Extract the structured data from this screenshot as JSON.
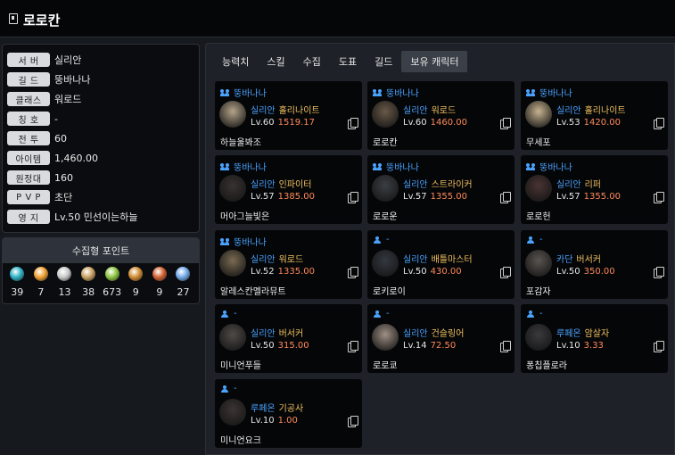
{
  "header": {
    "title": "로로칸"
  },
  "info": [
    {
      "label": "서   버",
      "value": "실리안"
    },
    {
      "label": "길   드",
      "value": "뚱바나나"
    },
    {
      "label": "클래스",
      "value": "워로드"
    },
    {
      "label": "칭   호",
      "value": "-"
    },
    {
      "label": "전   투",
      "value": "60"
    },
    {
      "label": "아이템",
      "value": "1,460.00"
    },
    {
      "label": "원정대",
      "value": "160"
    },
    {
      "label": "P V P",
      "value": "초단"
    },
    {
      "label": "영   지",
      "value": "Lv.50 민선이는하늘"
    }
  ],
  "collection": {
    "title": "수집형 포인트",
    "items": [
      {
        "icon": "island-heart-icon",
        "color": "#2bb0c4",
        "count": "39"
      },
      {
        "icon": "orpheus-star-icon",
        "color": "#f0a030",
        "count": "7"
      },
      {
        "icon": "giant-heart-icon",
        "color": "#c9c9c9",
        "count": "13"
      },
      {
        "icon": "art-piece-icon",
        "color": "#c8a060",
        "count": "38"
      },
      {
        "icon": "mokoko-seed-icon",
        "color": "#8cc63f",
        "count": "673"
      },
      {
        "icon": "voyage-icon",
        "color": "#d08a30",
        "count": "9"
      },
      {
        "icon": "world-tree-leaf-icon",
        "color": "#d06030",
        "count": "9"
      },
      {
        "icon": "ignea-token-icon",
        "color": "#6fa8e8",
        "count": "27"
      }
    ]
  },
  "tabs": [
    {
      "label": "능력치",
      "active": false
    },
    {
      "label": "스킬",
      "active": false
    },
    {
      "label": "수집",
      "active": false
    },
    {
      "label": "도표",
      "active": false
    },
    {
      "label": "길드",
      "active": false
    },
    {
      "label": "보유 캐릭터",
      "active": true
    }
  ],
  "characters": [
    {
      "guild": "뚱바나나",
      "server": "실리안",
      "job": "홀리나이트",
      "level": "Lv.60",
      "ilvl": "1519.17",
      "name": "하늘울봐조",
      "avatar": "#b5a48a"
    },
    {
      "guild": "뚱바나나",
      "server": "실리안",
      "job": "워로드",
      "level": "Lv.60",
      "ilvl": "1460.00",
      "name": "로로칸",
      "avatar": "#6a5a48"
    },
    {
      "guild": "뚱바나나",
      "server": "실리안",
      "job": "홀리나이트",
      "level": "Lv.53",
      "ilvl": "1420.00",
      "name": "무세포",
      "avatar": "#c8b490"
    },
    {
      "guild": "뚱바나나",
      "server": "실리안",
      "job": "인파이터",
      "level": "Lv.57",
      "ilvl": "1385.00",
      "name": "머아그늘빛은",
      "avatar": "#3a3232"
    },
    {
      "guild": "뚱바나나",
      "server": "실리안",
      "job": "스트라이커",
      "level": "Lv.57",
      "ilvl": "1355.00",
      "name": "로로운",
      "avatar": "#3b3f44"
    },
    {
      "guild": "뚱바나나",
      "server": "실리안",
      "job": "리퍼",
      "level": "Lv.57",
      "ilvl": "1355.00",
      "name": "로로헌",
      "avatar": "#4a3434"
    },
    {
      "guild": "뚱바나나",
      "server": "실리안",
      "job": "워로드",
      "level": "Lv.52",
      "ilvl": "1335.00",
      "name": "알레스칸멜라뮤트",
      "avatar": "#7a6a52"
    },
    {
      "guild": "-",
      "server": "실리안",
      "job": "배틀마스터",
      "level": "Lv.50",
      "ilvl": "430.00",
      "name": "로키로이",
      "avatar": "#333840"
    },
    {
      "guild": "-",
      "server": "카단",
      "job": "버서커",
      "level": "Lv.50",
      "ilvl": "350.00",
      "name": "포감자",
      "avatar": "#5a5550"
    },
    {
      "guild": "-",
      "server": "실리안",
      "job": "버서커",
      "level": "Lv.50",
      "ilvl": "315.00",
      "name": "미니언푸들",
      "avatar": "#4f4b47"
    },
    {
      "guild": "-",
      "server": "실리안",
      "job": "건슬링어",
      "level": "Lv.14",
      "ilvl": "72.50",
      "name": "로로쿄",
      "avatar": "#a09085"
    },
    {
      "guild": "-",
      "server": "루페온",
      "job": "암살자",
      "level": "Lv.10",
      "ilvl": "3.33",
      "name": "퐁칩플로라",
      "avatar": "#3a3a3e"
    },
    {
      "guild": "-",
      "server": "루페온",
      "job": "기공사",
      "level": "Lv.10",
      "ilvl": "1.00",
      "name": "미니언요크",
      "avatar": "#3c3434"
    }
  ]
}
